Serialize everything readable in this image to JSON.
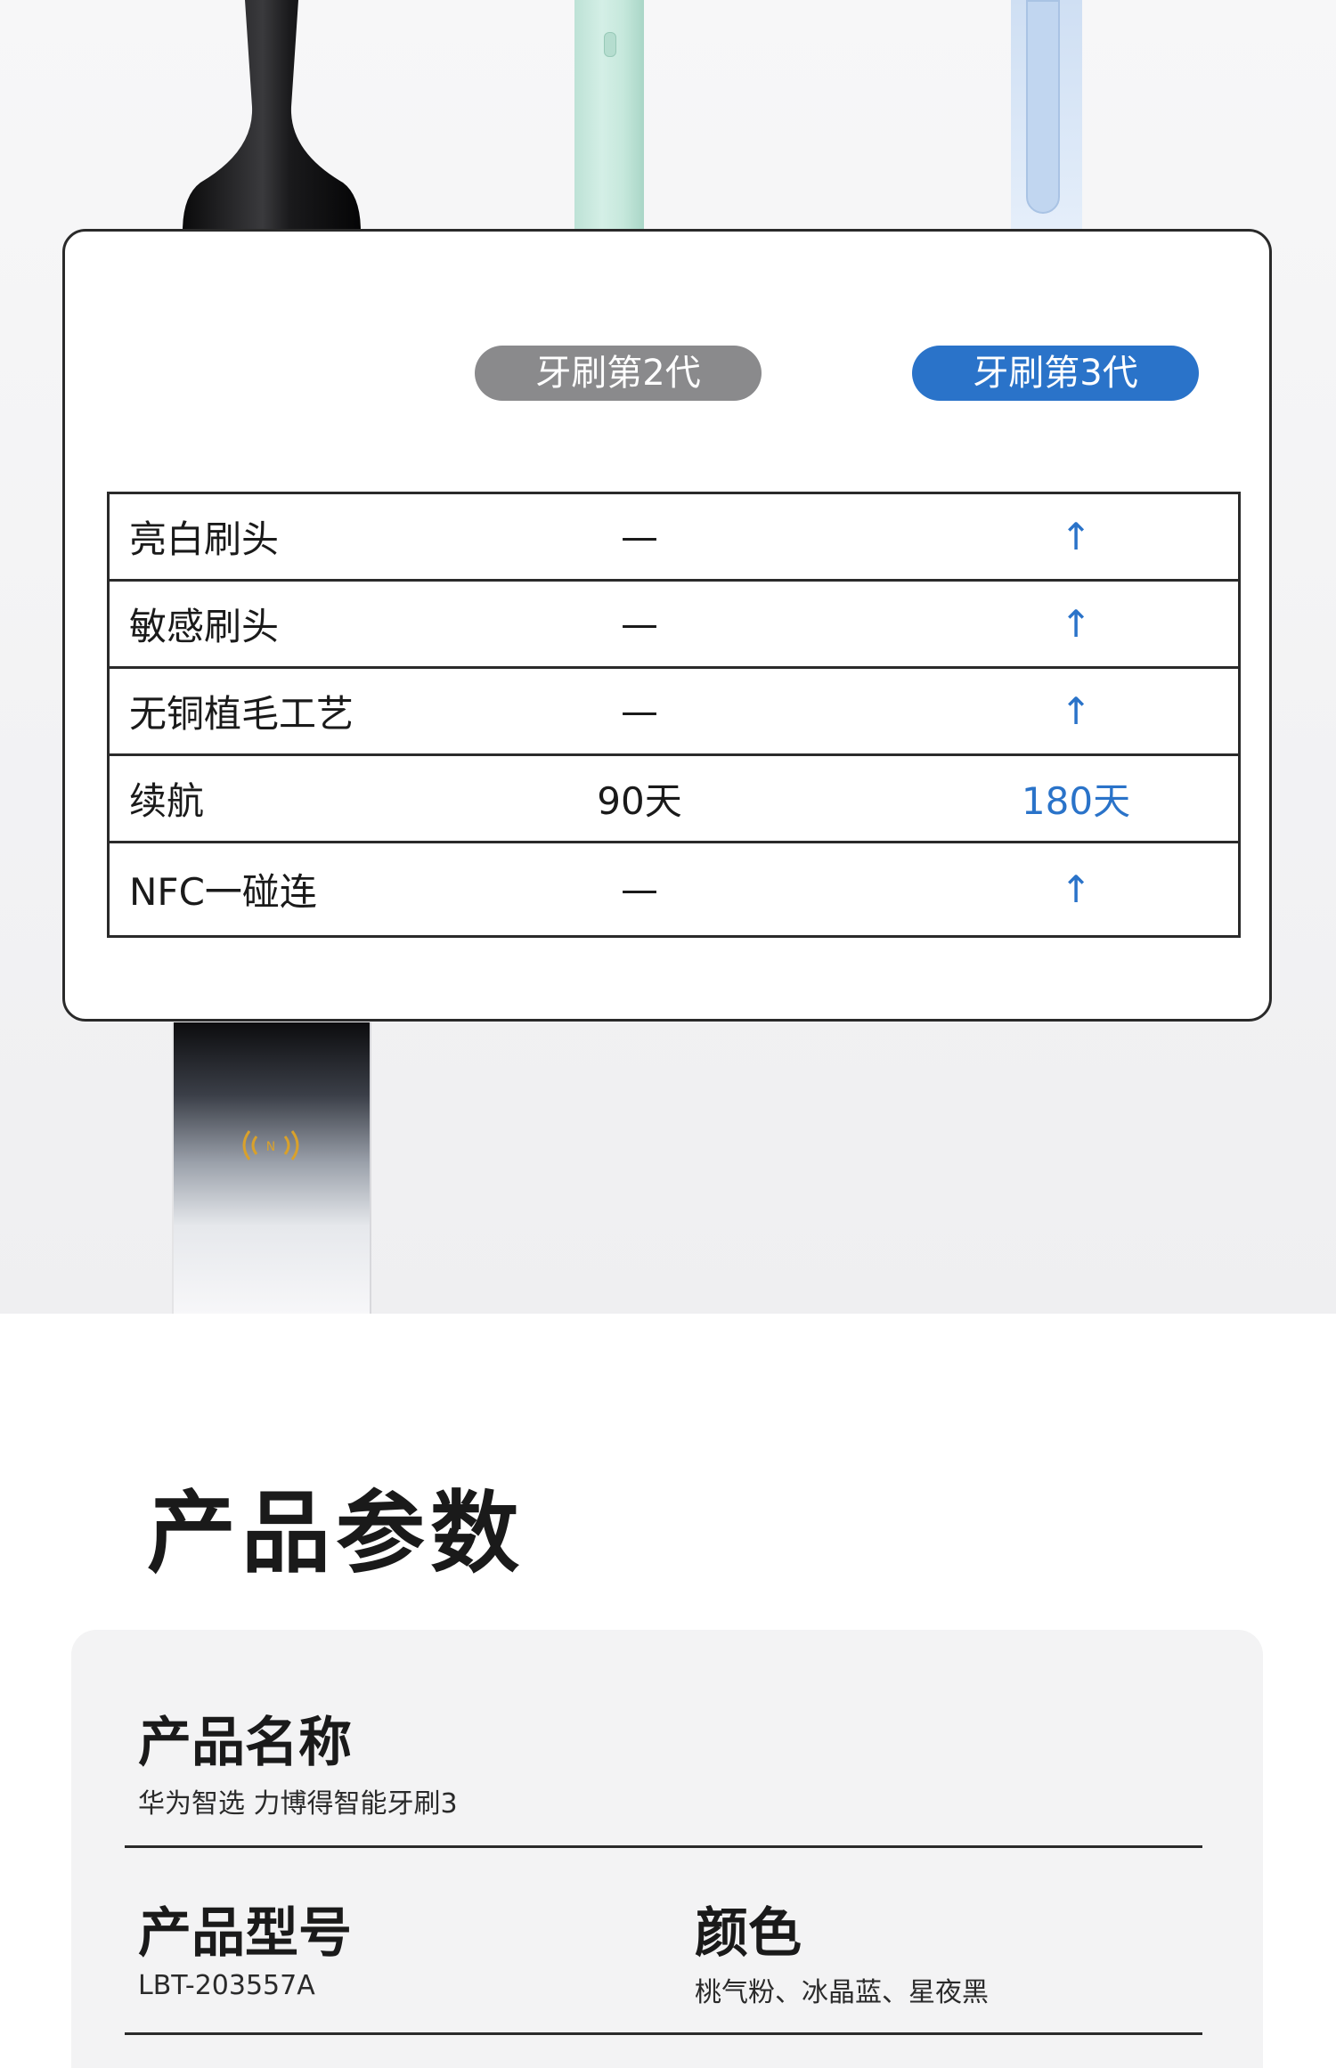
{
  "compare": {
    "pill_v2": "牙刷第2代",
    "pill_v3": "牙刷第3代",
    "rows": [
      {
        "feature": "亮白刷头",
        "v2": "—",
        "v3": "↑"
      },
      {
        "feature": "敏感刷头",
        "v2": "—",
        "v3": "↑"
      },
      {
        "feature": "无铜植毛工艺",
        "v2": "—",
        "v3": "↑"
      },
      {
        "feature": "续航",
        "v2": "90天",
        "v3": "180天"
      },
      {
        "feature": "NFC一碰连",
        "v2": "—",
        "v3": "↑"
      }
    ]
  },
  "params": {
    "title": "产品参数",
    "name_label": "产品名称",
    "name_value": "华为智选 力博得智能牙刷3",
    "model_label": "产品型号",
    "model_value": "LBT-203557A",
    "color_label": "颜色",
    "color_value": "桃气粉、冰晶蓝、星夜黑"
  },
  "colors": {
    "accent": "#2a73c9",
    "pill_gray": "#8a8a8c",
    "nfc_gold": "#d9a12b"
  }
}
